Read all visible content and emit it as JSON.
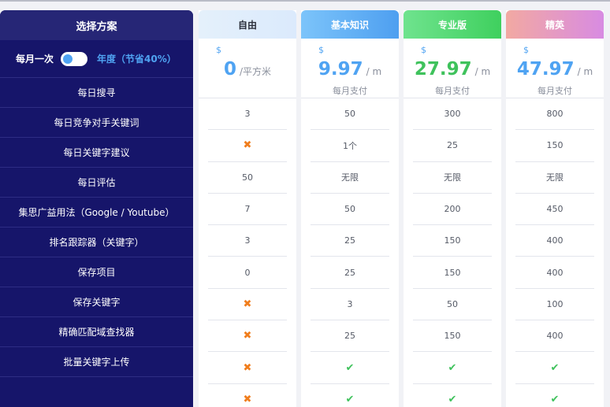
{
  "side": {
    "title": "选择方案",
    "toggle": {
      "monthly_label": "每月一次",
      "yearly_label": "年度（节省40%）"
    },
    "features": [
      "每日搜寻",
      "每日竞争对手关键词",
      "每日关键字建议",
      "每日评估",
      "集思广益用法（Google / Youtube）",
      "排名跟踪器（关键字）",
      "保存项目",
      "保存关键字",
      "精确匹配域查找器",
      "批量关键字上传"
    ]
  },
  "colors": {
    "sidebar": "#16156a",
    "accent_blue": "#4fa3f2",
    "accent_green": "#3fc25c",
    "cross_orange": "#f07d1c"
  },
  "plans": [
    {
      "name": "自由",
      "currency": "$",
      "price": "0",
      "unit": "/平方米",
      "note": "",
      "values": [
        "3",
        "✖",
        "50",
        "7",
        "3",
        "0",
        "✖",
        "✖",
        "✖",
        "✖"
      ]
    },
    {
      "name": "基本知识",
      "currency": "$",
      "price": "9.97",
      "unit": "/ m",
      "note": "每月支付",
      "values": [
        "50",
        "1个",
        "无限",
        "50",
        "25",
        "25",
        "3",
        "25",
        "✔",
        "✔"
      ]
    },
    {
      "name": "专业版",
      "currency": "$",
      "price": "27.97",
      "unit": "/ m",
      "note": "每月支付",
      "values": [
        "300",
        "25",
        "无限",
        "200",
        "150",
        "150",
        "50",
        "150",
        "✔",
        "✔"
      ]
    },
    {
      "name": "精英",
      "currency": "$",
      "price": "47.97",
      "unit": "/ m",
      "note": "每月支付",
      "values": [
        "800",
        "150",
        "无限",
        "450",
        "400",
        "400",
        "100",
        "400",
        "✔",
        "✔"
      ]
    }
  ]
}
